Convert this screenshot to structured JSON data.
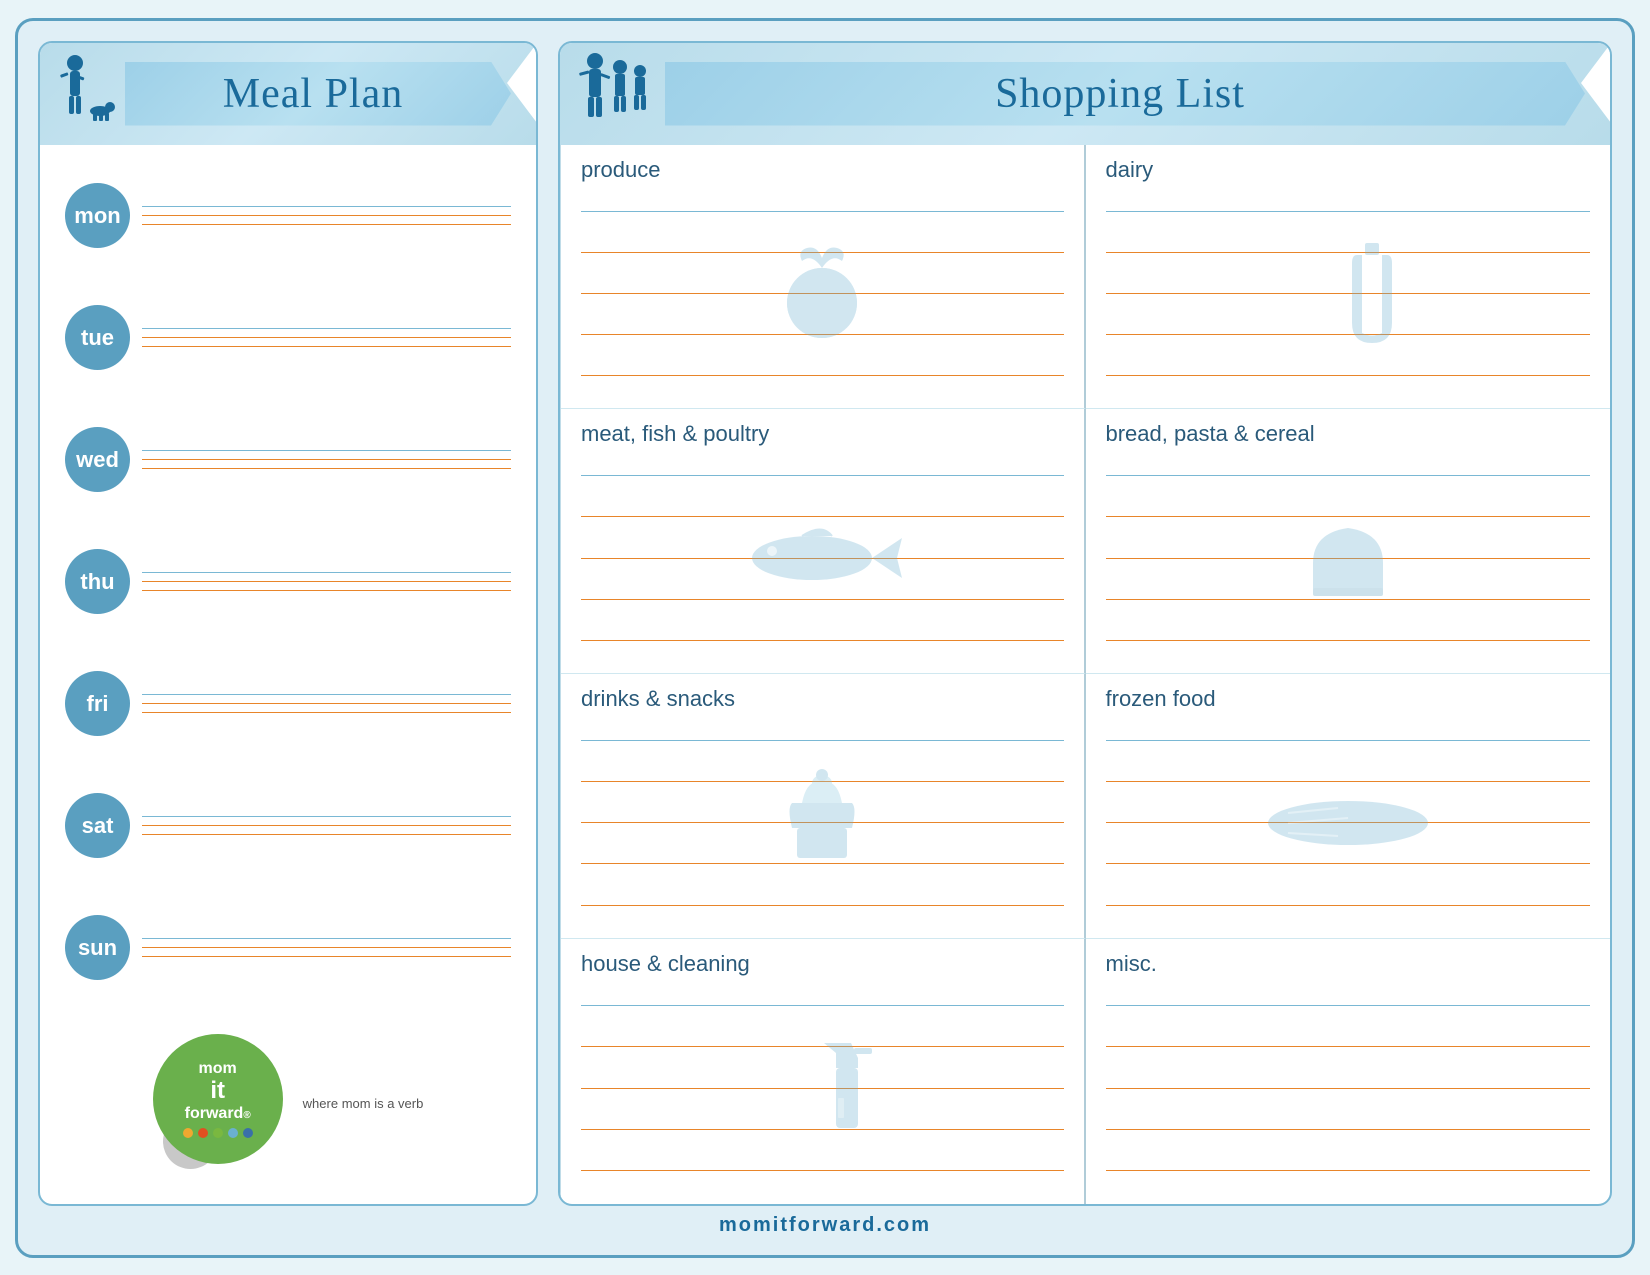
{
  "page": {
    "background_color": "#e0eff6",
    "border_color": "#5a9fc0"
  },
  "meal_plan": {
    "title": "Meal Plan",
    "days": [
      {
        "id": "mon",
        "label": "mon"
      },
      {
        "id": "tue",
        "label": "tue"
      },
      {
        "id": "wed",
        "label": "wed"
      },
      {
        "id": "thu",
        "label": "thu"
      },
      {
        "id": "fri",
        "label": "fri"
      },
      {
        "id": "sat",
        "label": "sat"
      },
      {
        "id": "sun",
        "label": "sun"
      }
    ]
  },
  "shopping_list": {
    "title": "Shopping List",
    "categories": [
      {
        "id": "produce",
        "label": "produce",
        "icon": "apple"
      },
      {
        "id": "dairy",
        "label": "dairy",
        "icon": "bottle"
      },
      {
        "id": "meat",
        "label": "meat, fish & poultry",
        "icon": "fish"
      },
      {
        "id": "bread",
        "label": "bread, pasta & cereal",
        "icon": "bread"
      },
      {
        "id": "drinks",
        "label": "drinks & snacks",
        "icon": "cupcake"
      },
      {
        "id": "frozen",
        "label": "frozen food",
        "icon": "frozen"
      },
      {
        "id": "house",
        "label": "house & cleaning",
        "icon": "spray"
      },
      {
        "id": "misc",
        "label": "misc.",
        "icon": "misc"
      }
    ]
  },
  "logo": {
    "mom": "mom",
    "it": "it",
    "forward": "forward",
    "registered": "®",
    "subtitle": "where mom is a verb",
    "dots": [
      "#f0a830",
      "#e05020",
      "#6ab04c",
      "#6ab0d0",
      "#3a70a8"
    ]
  },
  "footer": {
    "text": "momitforward.com"
  }
}
